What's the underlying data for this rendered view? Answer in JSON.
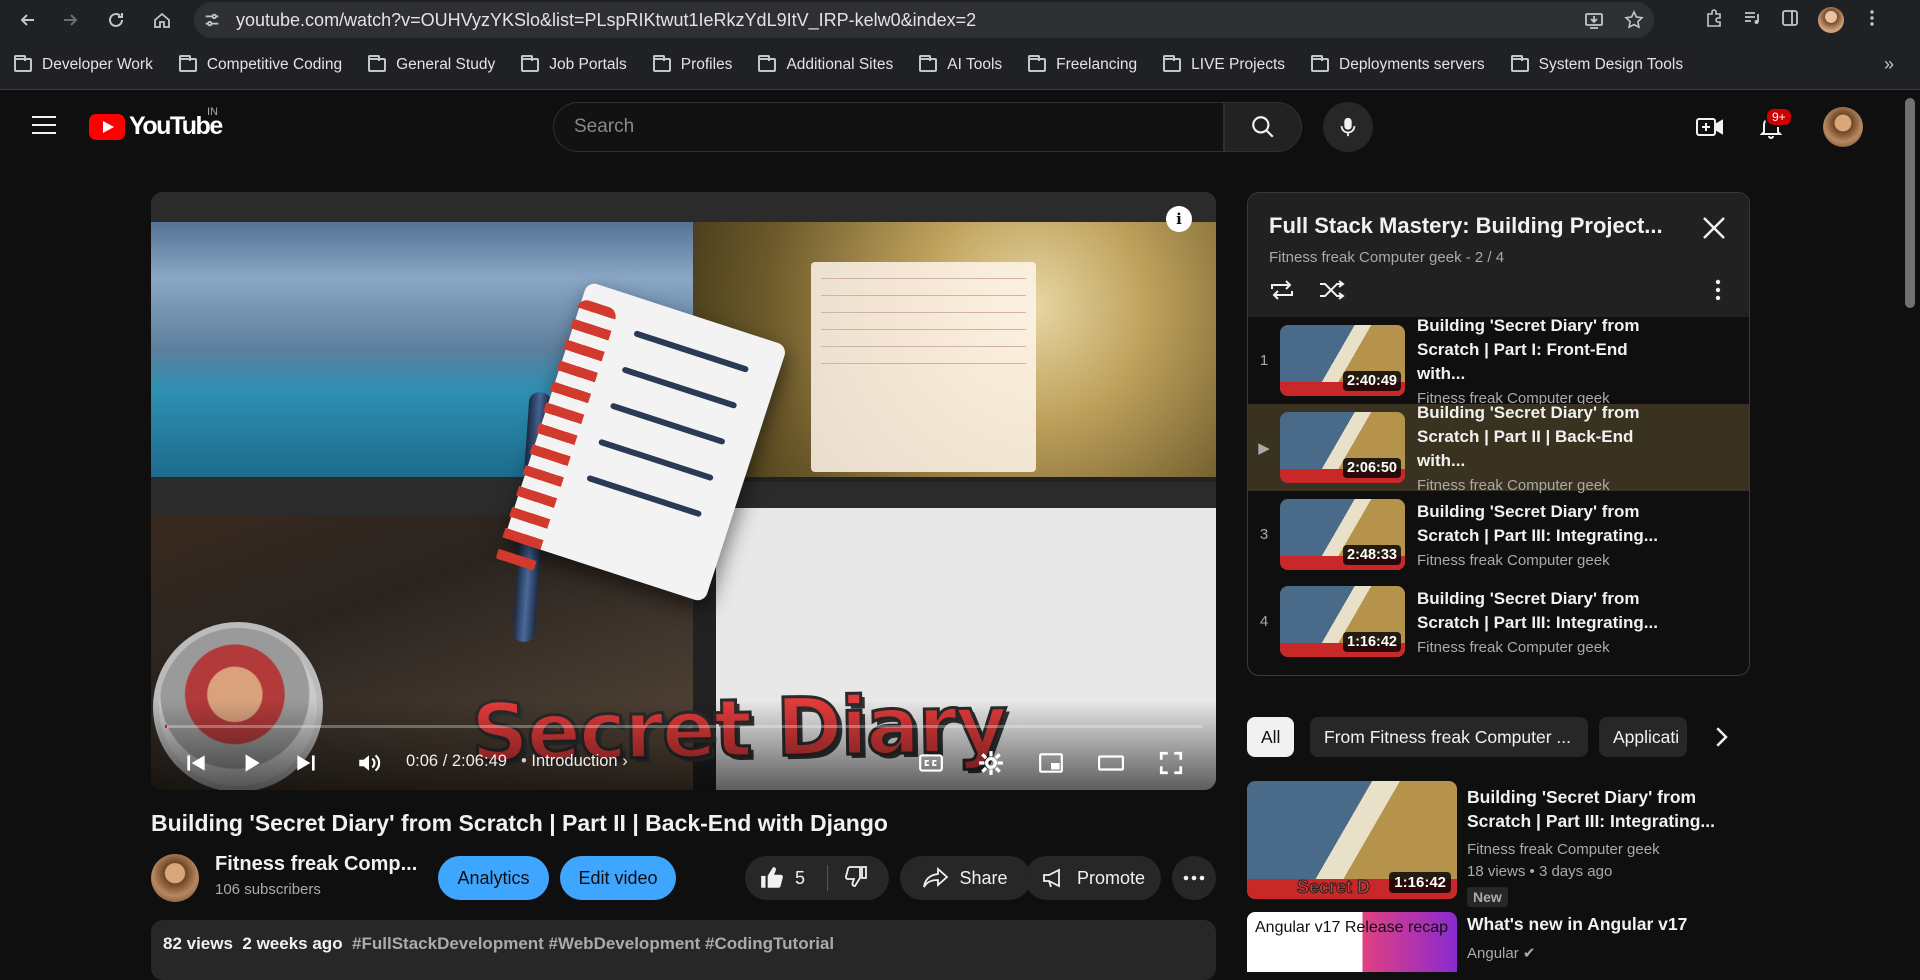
{
  "browser": {
    "url": "youtube.com/watch?v=OUHVyzYKSlo&list=PLspRIKtwut1IeRkzYdL9ItV_IRP-kelw0&index=2"
  },
  "bookmarks": [
    "Developer Work",
    "Competitive Coding",
    "General Study",
    "Job Portals",
    "Profiles",
    "Additional Sites",
    "AI Tools",
    "Freelancing",
    "LIVE Projects",
    "Deployments servers",
    "System Design Tools"
  ],
  "header": {
    "logo_text": "YouTube",
    "country_code": "IN",
    "search_placeholder": "Search",
    "notification_count": "9+"
  },
  "player": {
    "thumbnail_text": "Secret Diary",
    "time": "0:06 / 2:06:49",
    "chapter": "Introduction",
    "progress": 0.0005
  },
  "video": {
    "title": "Building 'Secret Diary' from Scratch | Part II | Back-End with Django",
    "channel": "Fitness freak Comp...",
    "subscribers": "106 subscribers",
    "analytics_label": "Analytics",
    "edit_label": "Edit video",
    "likes": "5",
    "share_label": "Share",
    "promote_label": "Promote",
    "views": "82 views",
    "age": "2 weeks ago",
    "tags": "#FullStackDevelopment #WebDevelopment #CodingTutorial"
  },
  "playlist": {
    "title": "Full Stack Mastery: Building Project...",
    "subtitle": "Fitness freak Computer geek - 2 / 4",
    "items": [
      {
        "index": "1",
        "title": "Building 'Secret Diary' from Scratch | Part I: Front-End with...",
        "channel": "Fitness freak Computer geek",
        "duration": "2:40:49"
      },
      {
        "index": "▶",
        "title": "Building 'Secret Diary' from Scratch | Part II | Back-End with...",
        "channel": "Fitness freak Computer geek",
        "duration": "2:06:50"
      },
      {
        "index": "3",
        "title": "Building 'Secret Diary' from Scratch | Part III: Integrating...",
        "channel": "Fitness freak Computer geek",
        "duration": "2:48:33"
      },
      {
        "index": "4",
        "title": "Building 'Secret Diary' from Scratch | Part III: Integrating...",
        "channel": "Fitness freak Computer geek",
        "duration": "1:16:42"
      }
    ]
  },
  "chips": [
    "All",
    "From Fitness freak Computer ...",
    "Applicati"
  ],
  "recommendations": [
    {
      "title": "Building 'Secret Diary' from Scratch | Part III: Integrating...",
      "channel": "Fitness freak Computer geek",
      "meta": "18 views  • 3 days ago",
      "badge": "New",
      "duration": "1:16:42",
      "thumb_text": "Secret D"
    },
    {
      "title": "What's new in Angular v17",
      "channel": "Angular",
      "thumb_text": "Angular v17 Release recap"
    }
  ]
}
